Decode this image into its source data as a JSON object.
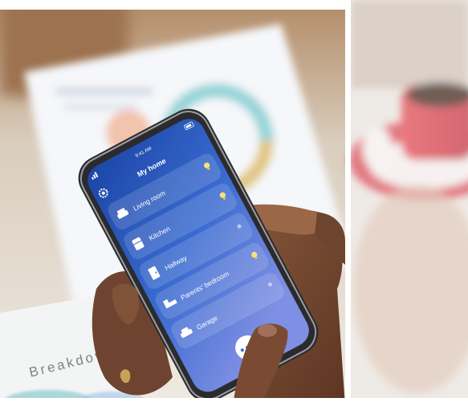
{
  "phone": {
    "status_bar": {
      "time": "9:41 AM",
      "signal_icon": "cell-signal-icon",
      "battery_icon": "battery-icon"
    },
    "header": {
      "title": "My home",
      "settings_icon": "gear-icon"
    },
    "rooms": [
      {
        "label": "Living room",
        "icon": "sofa-icon",
        "indicator": "bulb-on"
      },
      {
        "label": "Kitchen",
        "icon": "fridge-icon",
        "indicator": "bulb-on"
      },
      {
        "label": "Hallway",
        "icon": "door-icon",
        "indicator": "dot-off"
      },
      {
        "label": "Parents' bedroom",
        "icon": "bed-icon",
        "indicator": "bulb-on"
      },
      {
        "label": "Garage",
        "icon": "car-icon",
        "indicator": "dot-off"
      }
    ],
    "fab": {
      "icon": "more-dots-icon"
    },
    "colors": {
      "screen_top": "#1d4fb0",
      "screen_bottom": "#6a86e0",
      "bulb_on": "#f7e27a"
    }
  },
  "document": {
    "heading": "Breakdown"
  }
}
